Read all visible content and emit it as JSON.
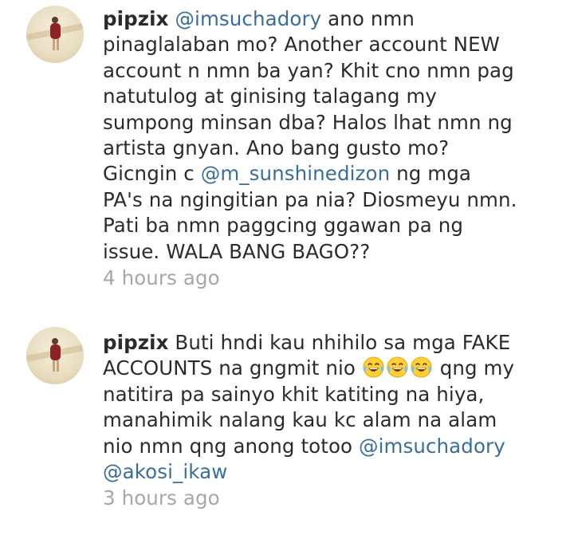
{
  "comments": [
    {
      "username": "pipzix",
      "avatar_icon": "avatar-photo-icon",
      "lines": [
        {
          "mention": "@imsuchadory",
          "text": " ano nmn"
        },
        {
          "text": "pinaglalaban mo? Another account NEW"
        },
        {
          "text": "account n nmn ba yan?  Khit cno nmn pag"
        },
        {
          "text": "natutulog at ginising talagang my"
        },
        {
          "text": "sumpong minsan dba? Halos lhat nmn ng"
        },
        {
          "text": "artista gnyan. Ano bang gusto mo?"
        },
        {
          "pre": "Gicngin c ",
          "mention": "@m_sunshinedizon",
          "text": " ng mga"
        },
        {
          "text": "PA's na ngingitian pa nia? Diosmeyu nmn."
        },
        {
          "text": "Pati ba nmn paggcing ggawan pa ng"
        },
        {
          "text": "issue. WALA BANG BAGO??"
        }
      ],
      "timestamp": "4 hours ago"
    },
    {
      "username": "pipzix",
      "avatar_icon": "avatar-photo-icon",
      "lines": [
        {
          "text": " Buti hndi kau nhihilo sa mga FAKE"
        },
        {
          "text": "ACCOUNTS na gngmit nio ",
          "emoji": [
            "laughing-tears-emoji",
            "laughing-tears-emoji",
            "laughing-tears-emoji"
          ],
          "after": " qng my"
        },
        {
          "text": "natitira pa sainyo khit katiting na hiya,"
        },
        {
          "text": "manahimik nalang kau kc alam na alam"
        },
        {
          "text": "nio nmn qng anong totoo ",
          "mention": "@imsuchadory"
        },
        {
          "mention": "@akosi_ikaw"
        }
      ],
      "timestamp": "3 hours ago"
    }
  ],
  "colors": {
    "text": "#2b2b2b",
    "mention": "#3a6e9a",
    "timestamp": "#a7a7a7",
    "background": "#ffffff"
  }
}
